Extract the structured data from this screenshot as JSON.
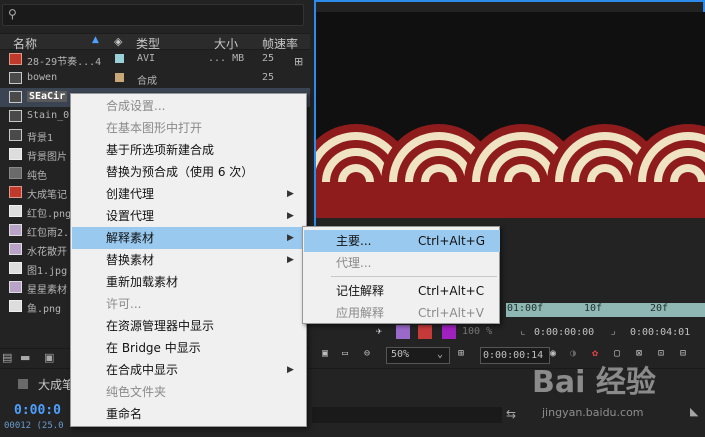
{
  "project": {
    "search_placeholder": "",
    "columns": {
      "name": "名称",
      "type": "类型",
      "size": "大小",
      "framerate": "帧速率"
    },
    "rows": [
      {
        "name": "28-29节奏...4",
        "label_color": "#9ad0d8",
        "type": "AVI",
        "size": "... MB",
        "fps": "25",
        "icon": "video-red"
      },
      {
        "name": "bowen",
        "label_color": "#c8a878",
        "type": "合成",
        "size": "",
        "fps": "25",
        "icon": "comp"
      },
      {
        "name": "SEaCir",
        "label_color": "",
        "type": "",
        "size": "",
        "fps": "",
        "icon": "comp"
      },
      {
        "name": "Stain_0",
        "label_color": "",
        "type": "",
        "size": "",
        "fps": "",
        "icon": "comp"
      },
      {
        "name": "背景1",
        "label_color": "",
        "type": "",
        "size": "",
        "fps": "",
        "icon": "comp"
      },
      {
        "name": "背景图片",
        "label_color": "",
        "type": "",
        "size": "",
        "fps": "",
        "icon": "doc"
      },
      {
        "name": "纯色",
        "label_color": "",
        "type": "",
        "size": "",
        "fps": "",
        "icon": "folder"
      },
      {
        "name": "大成笔记",
        "label_color": "",
        "type": "",
        "size": "",
        "fps": "",
        "icon": "video-red"
      },
      {
        "name": "红包.png",
        "label_color": "",
        "type": "",
        "size": "",
        "fps": "",
        "icon": "doc"
      },
      {
        "name": "红包雨2.",
        "label_color": "",
        "type": "",
        "size": "",
        "fps": "",
        "icon": "video"
      },
      {
        "name": "水花散开",
        "label_color": "",
        "type": "",
        "size": "",
        "fps": "",
        "icon": "video"
      },
      {
        "name": "图1.jpg",
        "label_color": "",
        "type": "",
        "size": "",
        "fps": "",
        "icon": "doc"
      },
      {
        "name": "星星素材",
        "label_color": "",
        "type": "",
        "size": "",
        "fps": "",
        "icon": "video"
      },
      {
        "name": "鱼.png",
        "label_color": "",
        "type": "",
        "size": "",
        "fps": "",
        "icon": "doc"
      }
    ]
  },
  "context_menu": {
    "items": [
      {
        "label": "合成设置...",
        "disabled": true
      },
      {
        "label": "在基本图形中打开",
        "disabled": true
      },
      {
        "label": "基于所选项新建合成",
        "disabled": false
      },
      {
        "label": "替换为预合成（使用 6 次）",
        "disabled": false
      },
      {
        "label": "创建代理",
        "disabled": false,
        "submenu": true
      },
      {
        "label": "设置代理",
        "disabled": false,
        "submenu": true
      },
      {
        "label": "解释素材",
        "disabled": false,
        "submenu": true,
        "highlighted": true
      },
      {
        "label": "替换素材",
        "disabled": false,
        "submenu": true
      },
      {
        "label": "重新加载素材",
        "disabled": false
      },
      {
        "label": "许可...",
        "disabled": true
      },
      {
        "label": "在资源管理器中显示",
        "disabled": false
      },
      {
        "label": "在 Bridge 中显示",
        "disabled": false
      },
      {
        "label": "在合成中显示",
        "disabled": false,
        "submenu": true
      },
      {
        "label": "纯色文件夹",
        "disabled": true
      },
      {
        "label": "重命名",
        "disabled": false
      }
    ]
  },
  "submenu": {
    "items": [
      {
        "label": "主要...",
        "shortcut": "Ctrl+Alt+G",
        "disabled": false,
        "highlighted": true
      },
      {
        "label": "代理...",
        "shortcut": "",
        "disabled": true
      },
      {
        "label": "记住解释",
        "shortcut": "Ctrl+Alt+C",
        "disabled": false
      },
      {
        "label": "应用解释",
        "shortcut": "Ctrl+Alt+V",
        "disabled": true
      }
    ]
  },
  "viewer": {
    "timeline_ticks": [
      "01:00f",
      "10f",
      "20f"
    ],
    "timecode_1": "0:00:00:00",
    "timecode_2": "0:00:04:01",
    "zoom": "50%",
    "timecode_current": "0:00:00:14",
    "percent": "100 %"
  },
  "bottom": {
    "comp_tab": "大成笔",
    "timecode": "0:00:0",
    "frame_info": "00012 (25.0"
  },
  "watermark": {
    "text": "Bai 经验",
    "url": "jingyan.baidu.com"
  },
  "colors": {
    "accent": "#2d8ceb",
    "menu_highlight": "#99c9ef",
    "ring_red": "#8e1c1c",
    "ring_cream": "#efe3c3"
  }
}
